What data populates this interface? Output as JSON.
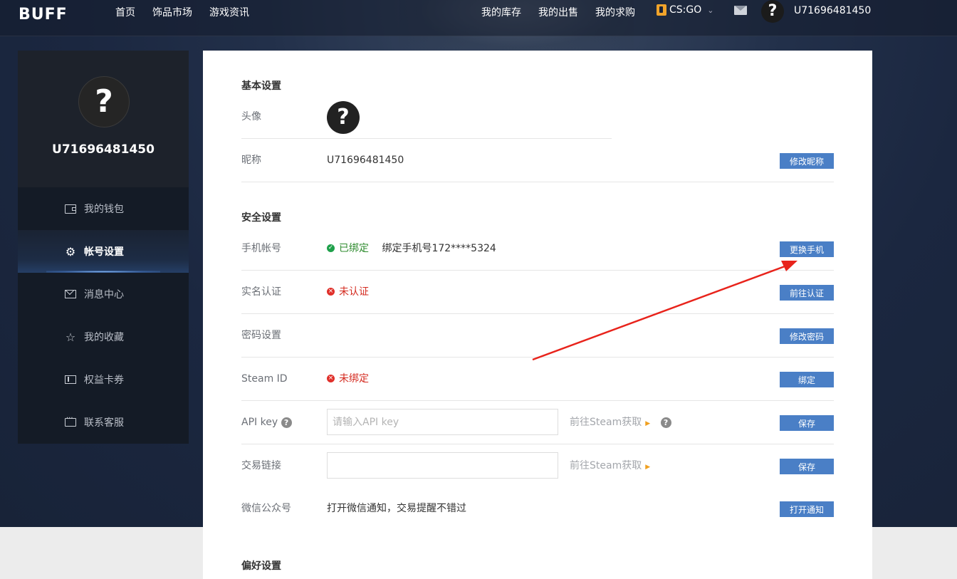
{
  "header": {
    "logo": "BUFF",
    "nav_left": [
      "首页",
      "饰品市场",
      "游戏资讯"
    ],
    "nav_right": [
      "我的库存",
      "我的出售",
      "我的求购"
    ],
    "game": "CS:GO",
    "avatar_glyph": "?",
    "username": "U71696481450"
  },
  "sidebar": {
    "avatar_glyph": "?",
    "username": "U71696481450",
    "items": [
      {
        "label": "我的钱包",
        "icon": "wallet-icon"
      },
      {
        "label": "帐号设置",
        "icon": "gear-icon",
        "active": true
      },
      {
        "label": "消息中心",
        "icon": "mail-icon"
      },
      {
        "label": "我的收藏",
        "icon": "star-icon"
      },
      {
        "label": "权益卡券",
        "icon": "card-icon"
      },
      {
        "label": "联系客服",
        "icon": "chat-icon"
      }
    ]
  },
  "basic": {
    "title": "基本设置",
    "avatar_label": "头像",
    "avatar_glyph": "?",
    "nickname_label": "昵称",
    "nickname_value": "U71696481450",
    "nickname_button": "修改昵称"
  },
  "security": {
    "title": "安全设置",
    "phone": {
      "label": "手机帐号",
      "status": "已绑定",
      "detail": "绑定手机号172****5324",
      "button": "更换手机"
    },
    "realname": {
      "label": "实名认证",
      "status": "未认证",
      "button": "前往认证"
    },
    "password": {
      "label": "密码设置",
      "button": "修改密码"
    },
    "steam_id": {
      "label": "Steam ID",
      "status": "未绑定",
      "button": "绑定"
    },
    "api_key": {
      "label": "API key",
      "placeholder": "请输入API key",
      "value": "",
      "link": "前往Steam获取",
      "button": "保存"
    },
    "trade_link": {
      "label": "交易链接",
      "placeholder": "",
      "value": "",
      "link": "前往Steam获取",
      "button": "保存"
    },
    "wechat": {
      "label": "微信公众号",
      "text": "打开微信通知，交易提醒不错过",
      "button": "打开通知"
    }
  },
  "preference": {
    "title": "偏好设置"
  },
  "colors": {
    "accent_button": "#4a7fc6",
    "ok": "#2e8b2e",
    "error": "#d42b20",
    "annotation_arrow": "#e8231b"
  }
}
